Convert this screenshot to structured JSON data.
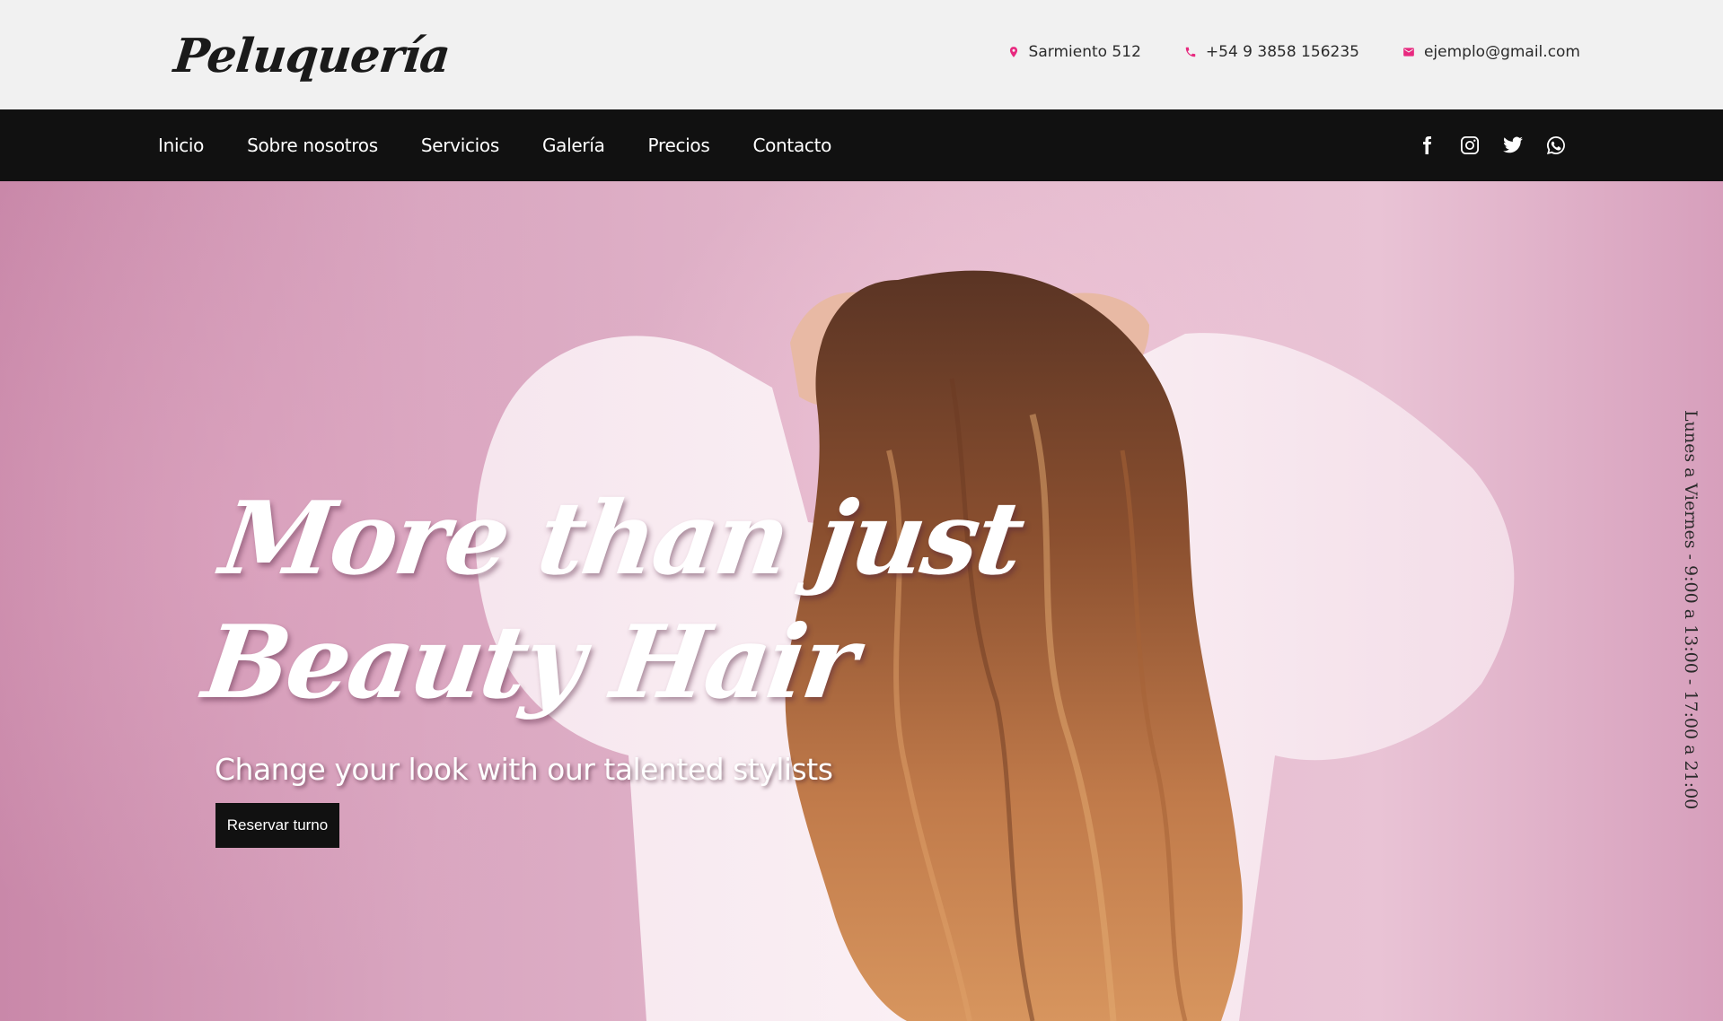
{
  "brand": {
    "name": "Peluquería",
    "accent": "#e8297f"
  },
  "contact": {
    "address": "Sarmiento 512",
    "phone": "+54 9 3858 156235",
    "email": "ejemplo@gmail.com"
  },
  "nav": {
    "items": [
      "Inicio",
      "Sobre nosotros",
      "Servicios",
      "Galería",
      "Precios",
      "Contacto"
    ],
    "social": [
      "facebook-icon",
      "instagram-icon",
      "twitter-icon",
      "whatsapp-icon"
    ]
  },
  "hero": {
    "headline_line1": "More than just",
    "headline_line2": "Beauty Hair",
    "subtitle": "Change your look with our talented stylists",
    "button": "Reservar turno",
    "hours": "Lunes a Viernes - 9:00 a 13:00 - 17:00 a 21:00"
  }
}
